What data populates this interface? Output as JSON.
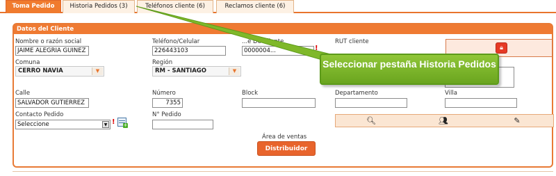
{
  "tabs": [
    {
      "label": "Toma Pedido",
      "active": true
    },
    {
      "label": "Historia Pedidos (3)",
      "active": false
    },
    {
      "label": "Teléfonos cliente (6)",
      "active": false
    },
    {
      "label": "Reclamos cliente (6)",
      "active": false
    }
  ],
  "panel": {
    "title": "Datos del Cliente"
  },
  "fields": {
    "nombre": {
      "label": "Nombre o razón social",
      "value": "JAIME ALEGRIA GUINEZ"
    },
    "telefono": {
      "label": "Teléfono/Celular",
      "value": "226443103"
    },
    "codigo": {
      "label": "...e De Cliente",
      "value": "0000004..."
    },
    "rut": {
      "label": "RUT cliente"
    },
    "comuna": {
      "label": "Comuna",
      "value": "CERRO NAVIA"
    },
    "region": {
      "label": "Región",
      "value": "RM - SANTIAGO"
    },
    "calle": {
      "label": "Calle",
      "value": "SALVADOR GUTIERREZ"
    },
    "numero": {
      "label": "Número",
      "value": "7355"
    },
    "block": {
      "label": "Block",
      "value": ""
    },
    "departamento": {
      "label": "Departamento",
      "value": ""
    },
    "villa": {
      "label": "Villa",
      "value": ""
    },
    "contacto": {
      "label": "Contacto Pedido",
      "value": "Seleccione"
    },
    "npedido": {
      "label": "N° Pedido",
      "value": ""
    },
    "area": {
      "label": "Área de ventas"
    }
  },
  "required_mark": "!",
  "distribuidor_button": "Distribuidor",
  "callout": {
    "text": "Seleccionar pestaña Historia Pedidos"
  },
  "colors": {
    "accent": "#ef7a32",
    "callout": "#7fb82a"
  }
}
